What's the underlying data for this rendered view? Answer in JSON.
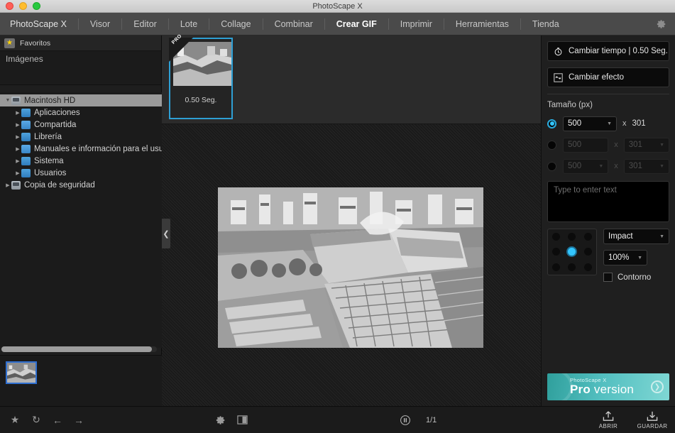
{
  "window": {
    "title": "PhotoScape X"
  },
  "menu": {
    "items": [
      {
        "label": "PhotoScape X",
        "active": false,
        "brand": true
      },
      {
        "label": "Visor",
        "active": false
      },
      {
        "label": "Editor",
        "active": false
      },
      {
        "label": "Lote",
        "active": false
      },
      {
        "label": "Collage",
        "active": false
      },
      {
        "label": "Combinar",
        "active": false
      },
      {
        "label": "Crear GIF",
        "active": true
      },
      {
        "label": "Imprimir",
        "active": false
      },
      {
        "label": "Herramientas",
        "active": false
      },
      {
        "label": "Tienda",
        "active": false
      }
    ],
    "settings_icon": "gear-icon"
  },
  "sidebar": {
    "favorites_label": "Favoritos",
    "favorites_icon": "star-icon",
    "images_label": "Imágenes",
    "tree": [
      {
        "label": "Macintosh HD",
        "icon": "disk-icon",
        "indent": 0,
        "expanded": true,
        "selected": true
      },
      {
        "label": "Aplicaciones",
        "icon": "folder-icon",
        "indent": 1,
        "expanded": false,
        "selected": false
      },
      {
        "label": "Compartida",
        "icon": "folder-icon",
        "indent": 1,
        "expanded": false,
        "selected": false
      },
      {
        "label": "Librería",
        "icon": "folder-icon",
        "indent": 1,
        "expanded": false,
        "selected": false
      },
      {
        "label": "Manuales e información para el usuario",
        "icon": "folder-icon",
        "indent": 1,
        "expanded": false,
        "selected": false
      },
      {
        "label": "Sistema",
        "icon": "folder-icon",
        "indent": 1,
        "expanded": false,
        "selected": false
      },
      {
        "label": "Usuarios",
        "icon": "folder-icon",
        "indent": 1,
        "expanded": false,
        "selected": false
      },
      {
        "label": "Copia de seguridad",
        "icon": "disk-icon",
        "indent": 0,
        "expanded": false,
        "selected": false
      }
    ]
  },
  "filmstrip": {
    "frames": [
      {
        "duration": "0.50 Seg.",
        "badge": "PRO",
        "selected": true
      }
    ]
  },
  "canvas": {
    "collapse_icon": "chevron-left-icon"
  },
  "rightpanel": {
    "change_time_label": "Cambiar tiempo | 0.50 Seg.",
    "change_time_icon": "timer-icon",
    "change_effect_label": "Cambiar efecto",
    "change_effect_icon": "effect-icon",
    "size_section_label": "Tamaño (px)",
    "size_rows": [
      {
        "selected": true,
        "width": "500",
        "height": "301",
        "x": "x",
        "width_dropdown": true,
        "height_dropdown": false,
        "enabled": true
      },
      {
        "selected": false,
        "width": "500",
        "height": "301",
        "x": "x",
        "width_dropdown": false,
        "height_dropdown": true,
        "enabled": false
      },
      {
        "selected": false,
        "width": "500",
        "height": "301",
        "x": "x",
        "width_dropdown": true,
        "height_dropdown": true,
        "enabled": false
      }
    ],
    "text_placeholder": "Type to enter text",
    "text_value": "",
    "font_name": "Impact",
    "font_size": "100%",
    "outline_label": "Contorno",
    "outline_checked": false,
    "position_selected_index": 4,
    "pro_banner": {
      "small": "PhotoScape X",
      "bold": "Pro",
      "rest": " version",
      "arrow_icon": "chevron-right-circle-icon",
      "accent": "#53bfc0"
    }
  },
  "bottombar": {
    "left_icons": [
      {
        "icon": "star-icon",
        "glyph": "★"
      },
      {
        "icon": "refresh-icon",
        "glyph": "↻"
      },
      {
        "icon": "back-arrow-icon",
        "glyph": "←"
      },
      {
        "icon": "forward-arrow-icon",
        "glyph": "→"
      }
    ],
    "settings_icon": "gear-icon",
    "split-view_icon": "split-square-icon",
    "play_icon": "pause-icon",
    "counter": "1/1",
    "open_label": "ABRIR",
    "open_icon": "upload-arrow-icon",
    "save_label": "GUARDAR",
    "save_icon": "download-arrow-icon"
  },
  "colors": {
    "accent": "#2bb3e8",
    "select_border": "#2e9fd4",
    "teal": "#53bfc0"
  }
}
